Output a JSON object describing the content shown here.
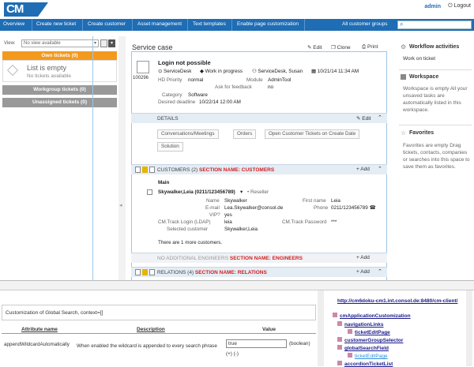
{
  "header": {
    "logo": "CM",
    "user": "admin",
    "logout": "Logout"
  },
  "nav": {
    "items": [
      "Overview",
      "Create new ticket",
      "Create customer",
      "Asset management",
      "Text templates",
      "Enable page customization",
      "All customer groups"
    ]
  },
  "left": {
    "view_label": "View:",
    "view_select": "No view available",
    "own_tickets": "Own tickets (0)",
    "empty_title": "List is empty",
    "empty_sub": "No tickets available",
    "workgroup": "Workgroup tickets (0)",
    "unassigned": "Unassigned tickets (0)"
  },
  "case": {
    "title": "Service case",
    "edit": "Edit",
    "clone": "Clone",
    "print": "Print",
    "subject": "Login not possible",
    "ticket_no": "100296",
    "queue": "ServiceDesk",
    "status": "Work in progress",
    "engineer": "ServiceDesk, Susan",
    "date": "10/21/14 11:34 AM",
    "priority_label": "HD Priority",
    "priority": "normal",
    "module_label": "Module",
    "module": "AdminTool",
    "feedback_label": "Ask for feedback",
    "feedback": "no",
    "category_label": "Category",
    "category": "Software",
    "deadline_label": "Desired deadline",
    "deadline": "10/22/14 12:00 AM"
  },
  "details": {
    "title": "DETAILS",
    "edit": "Edit",
    "tabs": [
      "Conversations/Meetings",
      "Orders",
      "Open Customer Tickets on Create Date",
      "Solution"
    ]
  },
  "customers": {
    "title": "CUSTOMERS (2)",
    "section_name": "SECTION NAME: CUSTOMERS",
    "add": "+ Add",
    "main": "Main",
    "contact": "Skywalker,Leia (0211/123456789)",
    "role": "Reseller",
    "name_label": "Name",
    "name": "Skywalker",
    "firstname_label": "First name",
    "firstname": "Leia",
    "email_label": "E-mail",
    "email": "Lea.Skywalker@consol.de",
    "phone_label": "Phone",
    "phone": "0211/123456789",
    "vip_label": "VIP?",
    "vip": "yes",
    "login_label": "CM.Track Login (LDAP)",
    "login": "leia",
    "password_label": "CM.Track Password",
    "password": "***",
    "selected_label": "Selected customer",
    "selected": "Skywalker,Leia",
    "more": "There are 1 more customers."
  },
  "engineers": {
    "title": "NO ADDITIONAL ENGINEERS",
    "section_name": "SECTION NAME: ENGINEERS",
    "add": "+ Add"
  },
  "relations": {
    "title": "RELATIONS (4)",
    "section_name": "SECTION NAME: RELATIONS",
    "add": "+ Add"
  },
  "right": {
    "workflow_title": "Workflow activities",
    "workflow_item": "Work on ticket",
    "workspace_title": "Workspace",
    "workspace_text": "Workspace is empty All your unsaved tasks are automatically listed in this workspace.",
    "favorites_title": "Favorites",
    "favorites_text": "Favorites are empty Drag tickets, contacts, companies or searches into this space to save them as favorites."
  },
  "bottom": {
    "caption": "Customization of Global Search, context=[]",
    "col_attr": "Attribute name",
    "col_desc": "Description",
    "col_value": "Value",
    "row_attr": "appendWildcardAutomatically",
    "row_desc": "When enabled the wildcard is appended to every search phrase",
    "row_value": "true",
    "row_type": "(boolean)",
    "row_pm": "(+) (-)",
    "tree_url": "http://cm6doku-cm1.int.consol.de:8480/cm-client/",
    "tree": [
      "cmApplicationCustomization",
      "navigationLinks",
      "ticketEditPage",
      "customerGroupSelector",
      "globalSearchField",
      "ticketEditPage",
      "accordionTicketList"
    ]
  }
}
